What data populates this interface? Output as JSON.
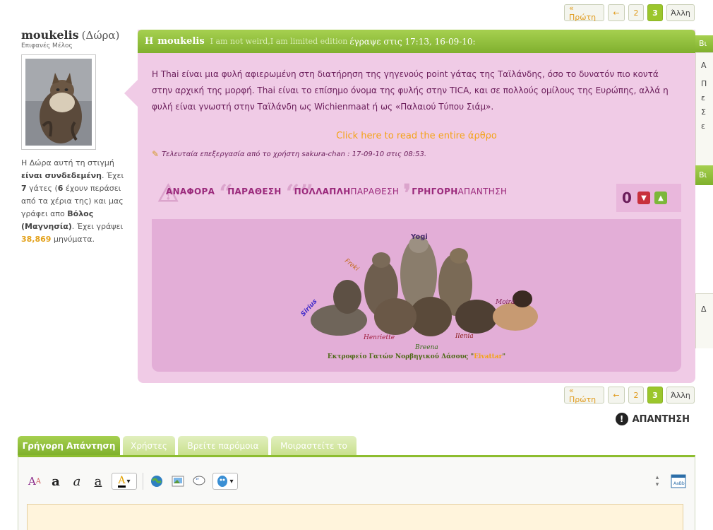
{
  "pagination": {
    "first": "« Πρώτη",
    "prev": "←",
    "page2": "2",
    "page3": "3",
    "other": "Άλλη"
  },
  "user": {
    "name": "moukelis",
    "name_gr": "(Δώρα)",
    "title": "Επιφανές Μέλος",
    "bio_1": "Η Δώρα αυτή τη στιγμή",
    "bio_online": "είναι συνδεδεμένη",
    "bio_2": ". Έχει",
    "bio_cats": "7",
    "bio_3": "γάτες (",
    "bio_six": "6",
    "bio_4": "έχουν περάσει από τα χέρια της) και μας γράφει απο",
    "bio_city": "Βόλος (Μαγνησία)",
    "bio_5": ". Έχει γράψει",
    "bio_posts": "38,869",
    "bio_6": "μηνύματα."
  },
  "post": {
    "head_h": "Η",
    "head_author": "moukelis",
    "head_sig": "I am not weird,I am limited edition",
    "head_wrote": "έγραψε στις 17:13, 16-09-10:",
    "text": "Η Thai είναι μια φυλή αφιερωμένη στη διατήρηση της γηγενούς point γάτας της Ταϊλάνδης, όσο το δυνατόν πιο κοντά στην αρχική της μορφή. Thai είναι το επίσημο όνομα της φυλής στην TICA, και σε πολλούς ομίλους της Ευρώπης, αλλά η φυλή είναι γνωστή στην Ταϊλάνδη ως Wichienmaat ή ως «Παλαιού Τύπου Σιάμ».",
    "read_more": "Click here to read the entire άρθρο",
    "edited": "Τελευταία επεξεργασία από το χρήστη sakura-chan : 17-09-10 στις 08:53.",
    "report": "ΑΝΑΦΟΡΑ",
    "quote": "ΠΑΡΑΘΕΣΗ",
    "multi_a": "ΠΟΛΛΑΠΛΗ",
    "multi_b": "ΠΑΡΑΘΕΣΗ",
    "quick_a": "ΓΡΗΓΟΡΗ",
    "quick_b": "ΑΠΑΝΤΗΣΗ",
    "rep_score": "0"
  },
  "signature": {
    "names": [
      "Yogi",
      "Freki",
      "Sirius",
      "Henriette",
      "Breena",
      "Ilenia",
      "Moira"
    ],
    "caption": "Εκτροφείο Γατών Νορβηγικού Δάσους \"",
    "caption_highlight": "Eivattar",
    "caption_end": "\""
  },
  "reply_button": "ΑΠΑΝΤΗΣΗ",
  "tabs": [
    "Γρήγορη Απάντηση",
    "Χρήστες",
    "Βρείτε παρόμοια",
    "Μοιραστείτε το"
  ],
  "toolbar": {
    "bold": "a",
    "italic": "a",
    "underline": "a"
  },
  "right_side": {
    "tab1": "Βι",
    "line1": "Α",
    "line2": "Π",
    "line3": "ε",
    "line4": "Σ",
    "line5": "ε",
    "tab2": "Βι",
    "line6": "Δ"
  },
  "colors": {
    "green": "#8dbd2f",
    "pink_bg": "#f0cbe6",
    "post_text": "#6a1d5a",
    "orange": "#f3a317"
  }
}
